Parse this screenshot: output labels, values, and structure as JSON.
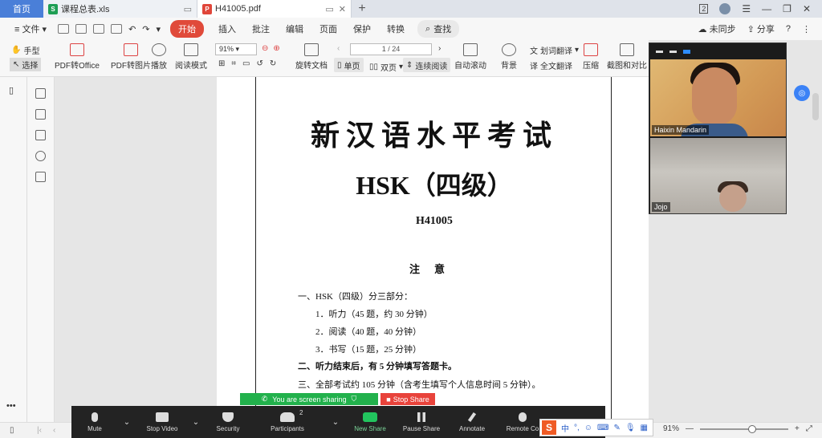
{
  "tabs": {
    "home": "首页",
    "items": [
      {
        "label": "课程总表.xls",
        "icon": "spreadsheet-icon",
        "color": "#1e9e54"
      },
      {
        "label": "H41005.pdf",
        "icon": "pdf-icon",
        "color": "#e0463a"
      }
    ],
    "plus": "+"
  },
  "window": {
    "page_badge": "2"
  },
  "menu": {
    "file": "文件",
    "start": "开始",
    "items": [
      "插入",
      "批注",
      "编辑",
      "页面",
      "保护",
      "转换"
    ],
    "search": "查找",
    "unsynced": "未同步",
    "share": "分享"
  },
  "ribbon": {
    "hand": "手型",
    "select": "选择",
    "pdf_to_office": "PDF转Office",
    "pdf_to_image": "PDF转图片",
    "play": "播放",
    "reading_mode": "阅读模式",
    "zoom": "91%",
    "rotate": "旋转文档",
    "page_indicator": "1 / 24",
    "single": "单页",
    "double": "双页",
    "continuous": "连续阅读",
    "auto_scroll": "自动滚动",
    "background": "背景",
    "word_translate": "划词翻译",
    "full_translate": "全文翻译",
    "compress": "压缩",
    "screenshot_compare": "截图和对比"
  },
  "document": {
    "title": "新汉语水平考试",
    "subtitle": "HSK（四级）",
    "code": "H41005",
    "notice": "注意",
    "lines": [
      {
        "text": "一、HSK（四级）分三部分：",
        "indent": false,
        "bold": false
      },
      {
        "text": "1．听力（45 题，约 30 分钟）",
        "indent": true,
        "bold": false
      },
      {
        "text": "2．阅读（40 题，40 分钟）",
        "indent": true,
        "bold": false
      },
      {
        "text": "3．书写（15 题，25 分钟）",
        "indent": true,
        "bold": false
      },
      {
        "text": "二、听力结束后，有 5 分钟填写答题卡。",
        "indent": false,
        "bold": true
      },
      {
        "text": "三、全部考试约 105 分钟（含考生填写个人信息时间 5 分钟）。",
        "indent": false,
        "bold": false
      }
    ]
  },
  "video": {
    "participant1": "Haixin Mandarin",
    "participant2": "Jojo"
  },
  "zoom": {
    "sharing_notice": "You are screen sharing",
    "stop_share": "Stop Share",
    "mute": "Mute",
    "stop_video": "Stop Video",
    "security": "Security",
    "participants": "Participants",
    "participants_count": "2",
    "new_share": "New Share",
    "pause_share": "Pause Share",
    "annotate": "Annotate",
    "remote_control": "Remote Co",
    "more": "..."
  },
  "ime": {
    "brand": "S",
    "lang": "中",
    "punct": "°,"
  },
  "statusbar": {
    "zoom": "91%",
    "more": "•••"
  }
}
